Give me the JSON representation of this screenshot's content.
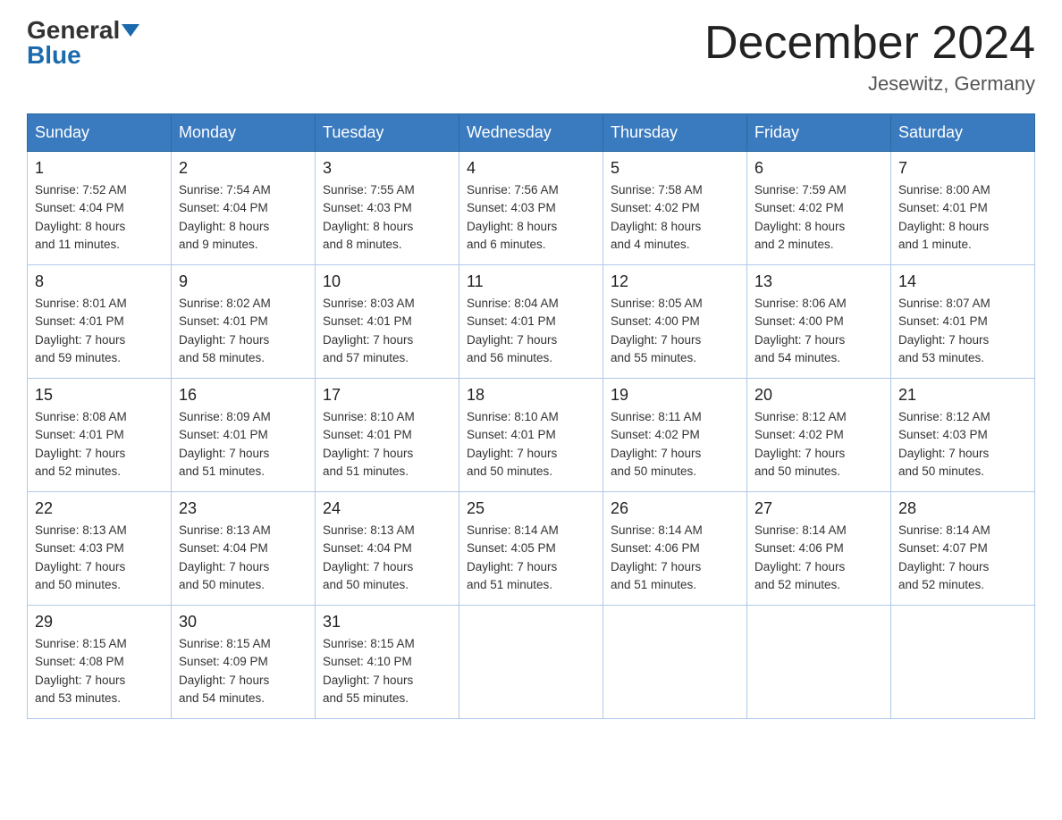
{
  "logo": {
    "general": "General",
    "blue": "Blue"
  },
  "title": "December 2024",
  "location": "Jesewitz, Germany",
  "days_of_week": [
    "Sunday",
    "Monday",
    "Tuesday",
    "Wednesday",
    "Thursday",
    "Friday",
    "Saturday"
  ],
  "weeks": [
    [
      {
        "day": "1",
        "sunrise": "7:52 AM",
        "sunset": "4:04 PM",
        "daylight": "8 hours and 11 minutes."
      },
      {
        "day": "2",
        "sunrise": "7:54 AM",
        "sunset": "4:04 PM",
        "daylight": "8 hours and 9 minutes."
      },
      {
        "day": "3",
        "sunrise": "7:55 AM",
        "sunset": "4:03 PM",
        "daylight": "8 hours and 8 minutes."
      },
      {
        "day": "4",
        "sunrise": "7:56 AM",
        "sunset": "4:03 PM",
        "daylight": "8 hours and 6 minutes."
      },
      {
        "day": "5",
        "sunrise": "7:58 AM",
        "sunset": "4:02 PM",
        "daylight": "8 hours and 4 minutes."
      },
      {
        "day": "6",
        "sunrise": "7:59 AM",
        "sunset": "4:02 PM",
        "daylight": "8 hours and 2 minutes."
      },
      {
        "day": "7",
        "sunrise": "8:00 AM",
        "sunset": "4:01 PM",
        "daylight": "8 hours and 1 minute."
      }
    ],
    [
      {
        "day": "8",
        "sunrise": "8:01 AM",
        "sunset": "4:01 PM",
        "daylight": "7 hours and 59 minutes."
      },
      {
        "day": "9",
        "sunrise": "8:02 AM",
        "sunset": "4:01 PM",
        "daylight": "7 hours and 58 minutes."
      },
      {
        "day": "10",
        "sunrise": "8:03 AM",
        "sunset": "4:01 PM",
        "daylight": "7 hours and 57 minutes."
      },
      {
        "day": "11",
        "sunrise": "8:04 AM",
        "sunset": "4:01 PM",
        "daylight": "7 hours and 56 minutes."
      },
      {
        "day": "12",
        "sunrise": "8:05 AM",
        "sunset": "4:00 PM",
        "daylight": "7 hours and 55 minutes."
      },
      {
        "day": "13",
        "sunrise": "8:06 AM",
        "sunset": "4:00 PM",
        "daylight": "7 hours and 54 minutes."
      },
      {
        "day": "14",
        "sunrise": "8:07 AM",
        "sunset": "4:01 PM",
        "daylight": "7 hours and 53 minutes."
      }
    ],
    [
      {
        "day": "15",
        "sunrise": "8:08 AM",
        "sunset": "4:01 PM",
        "daylight": "7 hours and 52 minutes."
      },
      {
        "day": "16",
        "sunrise": "8:09 AM",
        "sunset": "4:01 PM",
        "daylight": "7 hours and 51 minutes."
      },
      {
        "day": "17",
        "sunrise": "8:10 AM",
        "sunset": "4:01 PM",
        "daylight": "7 hours and 51 minutes."
      },
      {
        "day": "18",
        "sunrise": "8:10 AM",
        "sunset": "4:01 PM",
        "daylight": "7 hours and 50 minutes."
      },
      {
        "day": "19",
        "sunrise": "8:11 AM",
        "sunset": "4:02 PM",
        "daylight": "7 hours and 50 minutes."
      },
      {
        "day": "20",
        "sunrise": "8:12 AM",
        "sunset": "4:02 PM",
        "daylight": "7 hours and 50 minutes."
      },
      {
        "day": "21",
        "sunrise": "8:12 AM",
        "sunset": "4:03 PM",
        "daylight": "7 hours and 50 minutes."
      }
    ],
    [
      {
        "day": "22",
        "sunrise": "8:13 AM",
        "sunset": "4:03 PM",
        "daylight": "7 hours and 50 minutes."
      },
      {
        "day": "23",
        "sunrise": "8:13 AM",
        "sunset": "4:04 PM",
        "daylight": "7 hours and 50 minutes."
      },
      {
        "day": "24",
        "sunrise": "8:13 AM",
        "sunset": "4:04 PM",
        "daylight": "7 hours and 50 minutes."
      },
      {
        "day": "25",
        "sunrise": "8:14 AM",
        "sunset": "4:05 PM",
        "daylight": "7 hours and 51 minutes."
      },
      {
        "day": "26",
        "sunrise": "8:14 AM",
        "sunset": "4:06 PM",
        "daylight": "7 hours and 51 minutes."
      },
      {
        "day": "27",
        "sunrise": "8:14 AM",
        "sunset": "4:06 PM",
        "daylight": "7 hours and 52 minutes."
      },
      {
        "day": "28",
        "sunrise": "8:14 AM",
        "sunset": "4:07 PM",
        "daylight": "7 hours and 52 minutes."
      }
    ],
    [
      {
        "day": "29",
        "sunrise": "8:15 AM",
        "sunset": "4:08 PM",
        "daylight": "7 hours and 53 minutes."
      },
      {
        "day": "30",
        "sunrise": "8:15 AM",
        "sunset": "4:09 PM",
        "daylight": "7 hours and 54 minutes."
      },
      {
        "day": "31",
        "sunrise": "8:15 AM",
        "sunset": "4:10 PM",
        "daylight": "7 hours and 55 minutes."
      },
      null,
      null,
      null,
      null
    ]
  ],
  "labels": {
    "sunrise": "Sunrise:",
    "sunset": "Sunset:",
    "daylight": "Daylight:"
  }
}
